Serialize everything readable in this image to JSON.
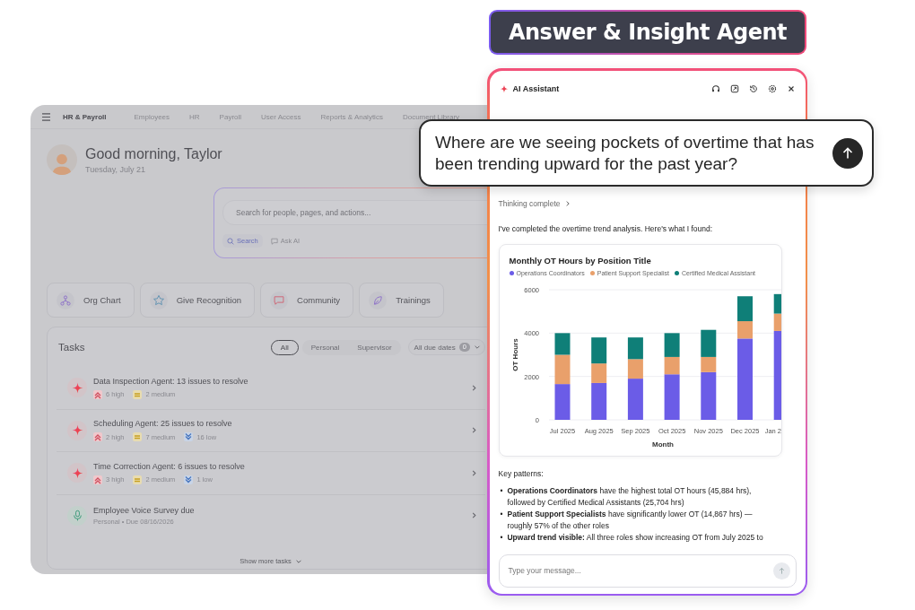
{
  "headline": {
    "text": "Answer & Insight Agent"
  },
  "dashboard": {
    "app_name": "HR & Payroll",
    "nav": [
      "Employees",
      "HR",
      "Payroll",
      "User Access",
      "Reports & Analytics",
      "Document Library"
    ],
    "greeting": "Good morning, Taylor",
    "date": "Tuesday, July 21",
    "search": {
      "placeholder": "Search for people, pages, and actions...",
      "modes": [
        {
          "kind": "search",
          "label": "Search",
          "selected": true
        },
        {
          "kind": "ask",
          "label": "Ask AI",
          "selected": false
        }
      ]
    },
    "quick_links": [
      {
        "kind": "org",
        "label": "Org Chart"
      },
      {
        "kind": "star",
        "label": "Give Recognition"
      },
      {
        "kind": "chat",
        "label": "Community"
      },
      {
        "kind": "leaf",
        "label": "Trainings"
      }
    ],
    "tasks": {
      "title": "Tasks",
      "filters": [
        {
          "label": "All",
          "selected": true
        },
        {
          "label": "Personal",
          "selected": false
        },
        {
          "label": "Supervisor",
          "selected": false
        }
      ],
      "due_filter": {
        "label": "All due dates",
        "count": "0"
      },
      "items": [
        {
          "kind": "agent",
          "title": "Data Inspection Agent: 13 issues to resolve",
          "tags": [
            {
              "kind": "high",
              "label": "6 high"
            },
            {
              "kind": "medium",
              "label": "2 medium"
            }
          ]
        },
        {
          "kind": "agent",
          "title": "Scheduling Agent: 25 issues to resolve",
          "tags": [
            {
              "kind": "high",
              "label": "2 high"
            },
            {
              "kind": "medium",
              "label": "7 medium"
            },
            {
              "kind": "low",
              "label": "16 low"
            }
          ]
        },
        {
          "kind": "agent",
          "title": "Time Correction Agent: 6 issues to resolve",
          "tags": [
            {
              "kind": "high",
              "label": "3 high"
            },
            {
              "kind": "medium",
              "label": "2 medium"
            },
            {
              "kind": "low",
              "label": "1 low"
            }
          ]
        },
        {
          "kind": "survey",
          "title": "Employee Voice Survey due",
          "subtitle": "Personal • Due 08/16/2026"
        }
      ],
      "show_more": "Show more tasks"
    }
  },
  "assistant": {
    "title": "AI Assistant",
    "prompt": "Where are we seeing pockets of overtime that has been trending upward for the past year?",
    "status": "Thinking complete",
    "intro": "I've completed the overtime trend analysis. Here's what I found:",
    "chart_data": {
      "type": "bar",
      "title": "Monthly OT Hours by Position Title",
      "xlabel": "Month",
      "ylabel": "OT Hours",
      "categories": [
        "Jul 2025",
        "Aug 2025",
        "Sep 2025",
        "Oct 2025",
        "Nov 2025",
        "Dec 2025",
        "Jan 2"
      ],
      "series": [
        {
          "name": "Operations Coordinators",
          "color": "#6b5ce7",
          "values": [
            1650,
            1700,
            1900,
            2100,
            2200,
            3750,
            4100
          ]
        },
        {
          "name": "Patient Support Specialist",
          "color": "#e9a06b",
          "values": [
            1350,
            900,
            900,
            800,
            700,
            800,
            800
          ]
        },
        {
          "name": "Certified Medical Assistant",
          "color": "#0f7f78",
          "values": [
            1000,
            1200,
            1000,
            1100,
            1250,
            1150,
            900
          ]
        }
      ],
      "ylim": [
        0,
        6000
      ],
      "yticks": [
        0,
        2000,
        4000,
        6000
      ],
      "stacked": true,
      "legend": "top"
    },
    "patterns_title": "Key patterns:",
    "patterns": [
      {
        "marker": "•",
        "text": "**Operations Coordinators** have the highest total OT hours (45,884 hrs), followed by Certified Medical Assistants (25,704 hrs)"
      },
      {
        "marker": "•",
        "text": "**Patient Support Specialists** have significantly lower OT (14,867 hrs) — roughly 57% of the other roles"
      },
      {
        "marker": "•",
        "text": "**Upward trend visible:** All three roles show increasing OT from July 2025 to"
      }
    ],
    "input": {
      "placeholder": "Type your message..."
    }
  }
}
